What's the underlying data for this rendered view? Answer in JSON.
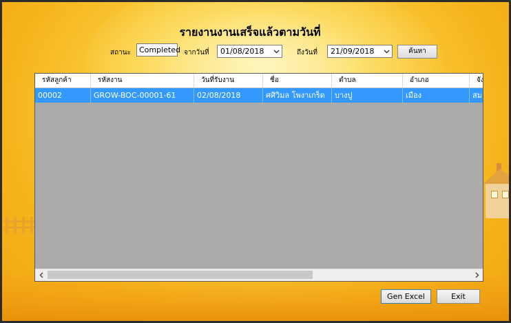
{
  "title": "รายงานงานเสร็จแล้วตามวันที่",
  "filters": {
    "status_label": "สถานะ",
    "status_value": "Completed",
    "from_label": "จากวันที่",
    "from_value": "01/08/2018",
    "to_label": "ถึงวันที่",
    "to_value": "21/09/2018",
    "search_label": "ค้นหา"
  },
  "grid": {
    "columns": [
      "รหัสลูกค้า",
      "รหัสงาน",
      "วันที่รับงาน",
      "ชื่อ",
      "ตำบล",
      "อำเภอ",
      "จัง"
    ],
    "rows": [
      [
        "00002",
        "GROW-BOC-00001-61",
        "02/08/2018",
        "ศศิวิมล โพงาเกร็ด",
        "บางปู",
        "เมือง",
        "สม"
      ]
    ],
    "selected_row": 0,
    "row_color": "#3399ff"
  },
  "buttons": {
    "gen_excel": "Gen Excel",
    "exit": "Exit"
  },
  "icons": {
    "combo_arrow": "chevron-down-icon",
    "scroll_left": "chevron-left-icon",
    "scroll_right": "chevron-right-icon"
  }
}
